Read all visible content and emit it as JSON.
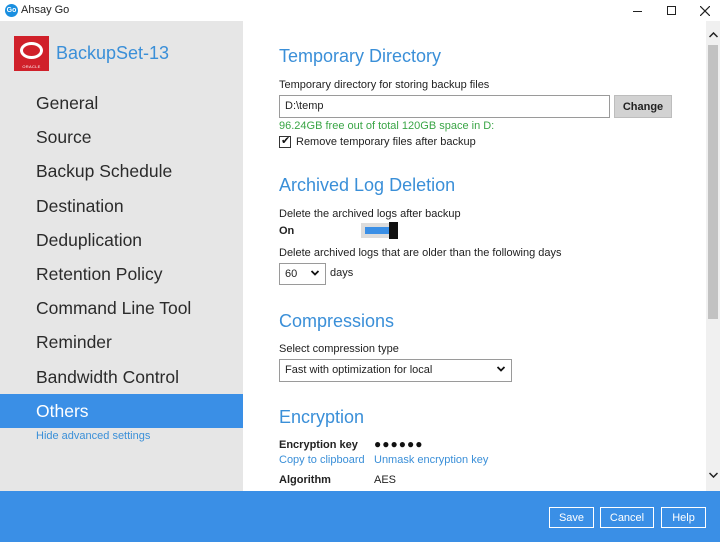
{
  "window": {
    "title": "Ahsay Go",
    "app_icon_text": "Go",
    "icon": "ahsay-go-app-icon"
  },
  "sidebar": {
    "brand_name": "BackupSet-13",
    "brand_logo_text": "ORACLE",
    "items": [
      {
        "label": "General"
      },
      {
        "label": "Source"
      },
      {
        "label": "Backup Schedule"
      },
      {
        "label": "Destination"
      },
      {
        "label": "Deduplication"
      },
      {
        "label": "Retention Policy"
      },
      {
        "label": "Command Line Tool"
      },
      {
        "label": "Reminder"
      },
      {
        "label": "Bandwidth Control"
      },
      {
        "label": "Others",
        "active": true
      }
    ],
    "hide_advanced": "Hide advanced settings"
  },
  "temp_dir": {
    "title": "Temporary Directory",
    "label": "Temporary directory for storing backup files",
    "value": "D:\\temp",
    "change_button": "Change",
    "free_space": "96.24GB free out of total 120GB space in D:",
    "remove_checkbox_label": "Remove temporary files after backup",
    "remove_checked": true
  },
  "archived_log": {
    "title": "Archived Log Deletion",
    "delete_label": "Delete the archived logs after backup",
    "toggle_state": "On",
    "older_label": "Delete archived logs that are older than the following days",
    "days_value": "60",
    "days_unit": "days"
  },
  "compression": {
    "title": "Compressions",
    "label": "Select compression type",
    "value": "Fast with optimization for local"
  },
  "encryption": {
    "title": "Encryption",
    "key_label": "Encryption key",
    "key_value": "●●●●●●",
    "copy_link": "Copy to clipboard",
    "unmask_link": "Unmask encryption key",
    "algorithm_label": "Algorithm",
    "algorithm_value": "AES"
  },
  "footer": {
    "save": "Save",
    "cancel": "Cancel",
    "help": "Help"
  },
  "colors": {
    "accent": "#3a8fe6",
    "link": "#3a8fd8",
    "success_text": "#3aa546",
    "sidebar_bg": "#e6e6e6",
    "brand_red": "#d0202a"
  }
}
